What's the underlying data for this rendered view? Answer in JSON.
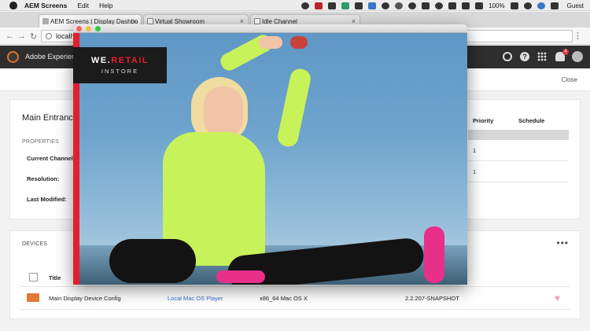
{
  "menubar": {
    "app": "AEM Screens",
    "items": [
      "Edit",
      "Help"
    ],
    "battery": "100%",
    "user": "Guest"
  },
  "browser": {
    "tabs": [
      {
        "title": "AEM Screens | Display Dashbo"
      },
      {
        "title": "Virtual Showroom"
      },
      {
        "title": "Idle Channel"
      }
    ],
    "address": "localhost"
  },
  "aem": {
    "brand": "Adobe Experience",
    "notification_count": "4",
    "close_label": "Close"
  },
  "display": {
    "title": "Main Entrance",
    "properties_header": "PROPERTIES",
    "labels": [
      "Current Channel:",
      "Resolution:",
      "Last Modified:"
    ],
    "schedule_columns": [
      "Priority",
      "Schedule"
    ],
    "schedule_rows": [
      "1",
      "1"
    ]
  },
  "devices": {
    "header": "DEVICES",
    "more": "•••",
    "title_column": "Title",
    "rows": [
      {
        "title": "Main Display Device Config",
        "player": "Local Mac OS Player",
        "platform": "x86_64 Mac OS X",
        "version": "2.2.207-SNAPSHOT"
      }
    ]
  },
  "player": {
    "logo_line1_a": "WE.",
    "logo_line1_b": "RETAIL",
    "logo_line2": "INSTORE"
  },
  "colors": {
    "aem_header": "#2e2e2e",
    "retail_red": "#e0202e",
    "link_blue": "#326ec8"
  }
}
